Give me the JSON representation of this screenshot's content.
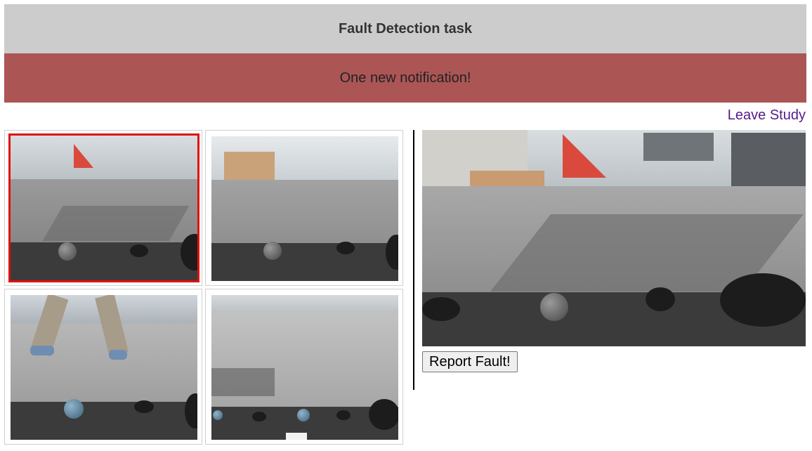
{
  "header": {
    "title": "Fault Detection task"
  },
  "notification": {
    "text": "One new notification!",
    "color": "#ab5555"
  },
  "links": {
    "leave_study": "Leave Study"
  },
  "camera_grid": {
    "feed_count": 4,
    "selected_index": 0,
    "selected_border_color": "#e01010"
  },
  "actions": {
    "report_fault_label": "Report Fault!"
  }
}
